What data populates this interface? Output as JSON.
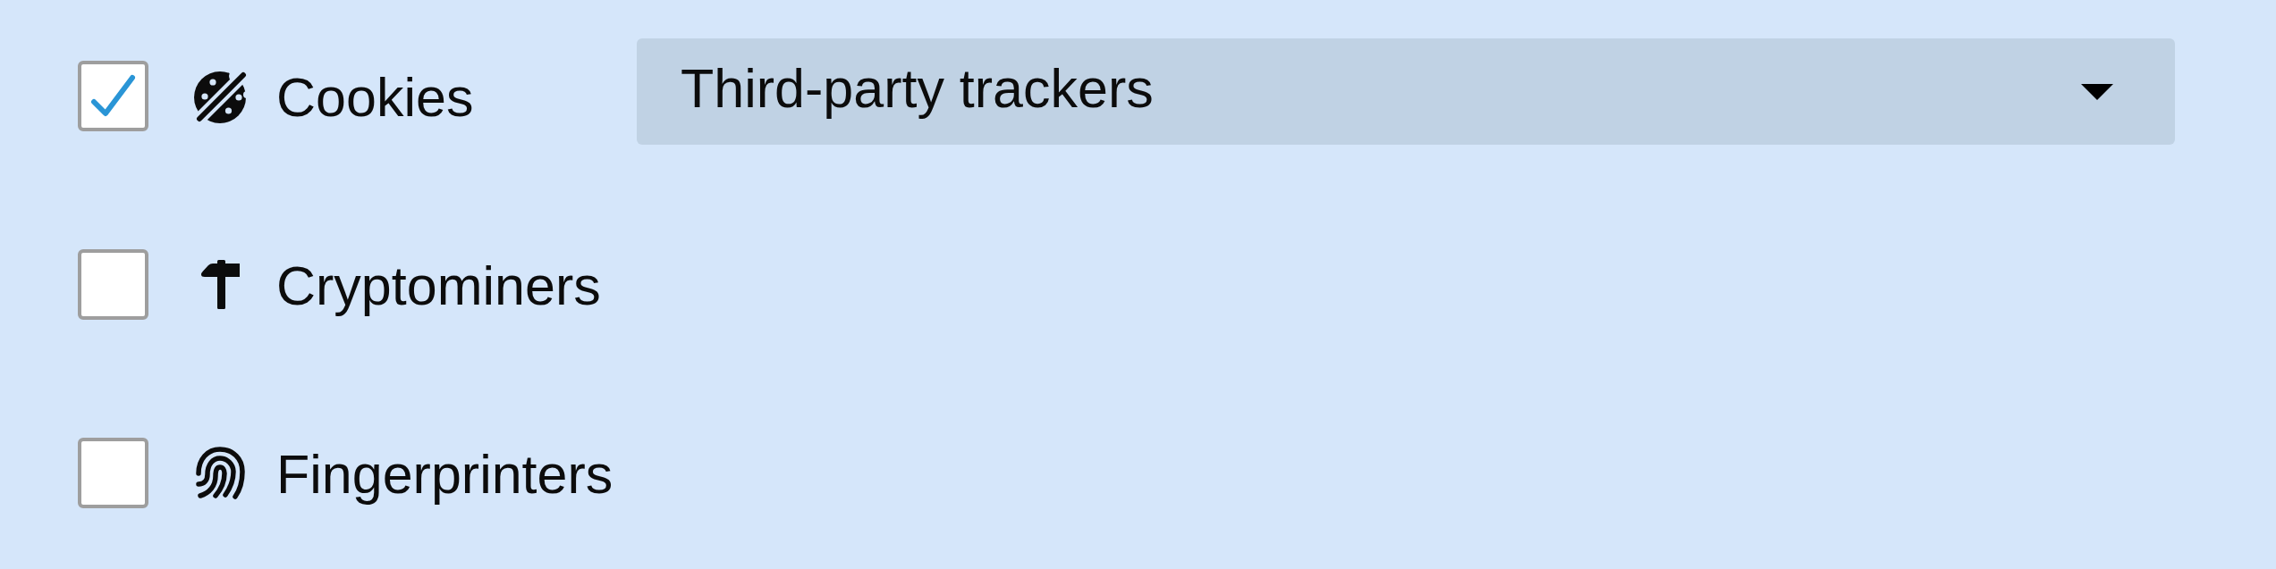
{
  "filters": [
    {
      "label": "Cookies",
      "checked": true,
      "dropdown": {
        "value": "Third-party trackers"
      }
    },
    {
      "label": "Cryptominers",
      "checked": false
    },
    {
      "label": "Fingerprinters",
      "checked": false
    }
  ]
}
